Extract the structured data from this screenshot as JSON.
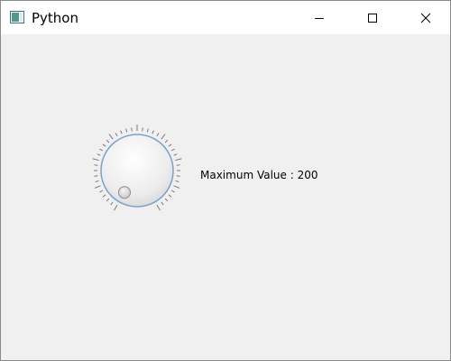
{
  "window": {
    "title": "Python",
    "app_icon": "python-app-icon",
    "controls": {
      "minimize_icon": "minimize-icon",
      "maximize_icon": "maximize-icon",
      "close_icon": "close-icon"
    }
  },
  "dial": {
    "icon": "dial-knob",
    "maximum": 200,
    "value_fraction": 0.0
  },
  "label": {
    "text": "Maximum Value : 200"
  },
  "colors": {
    "client_bg": "#f0f0f0",
    "titlebar_bg": "#ffffff",
    "dial_ring": "#7aa0c8"
  }
}
